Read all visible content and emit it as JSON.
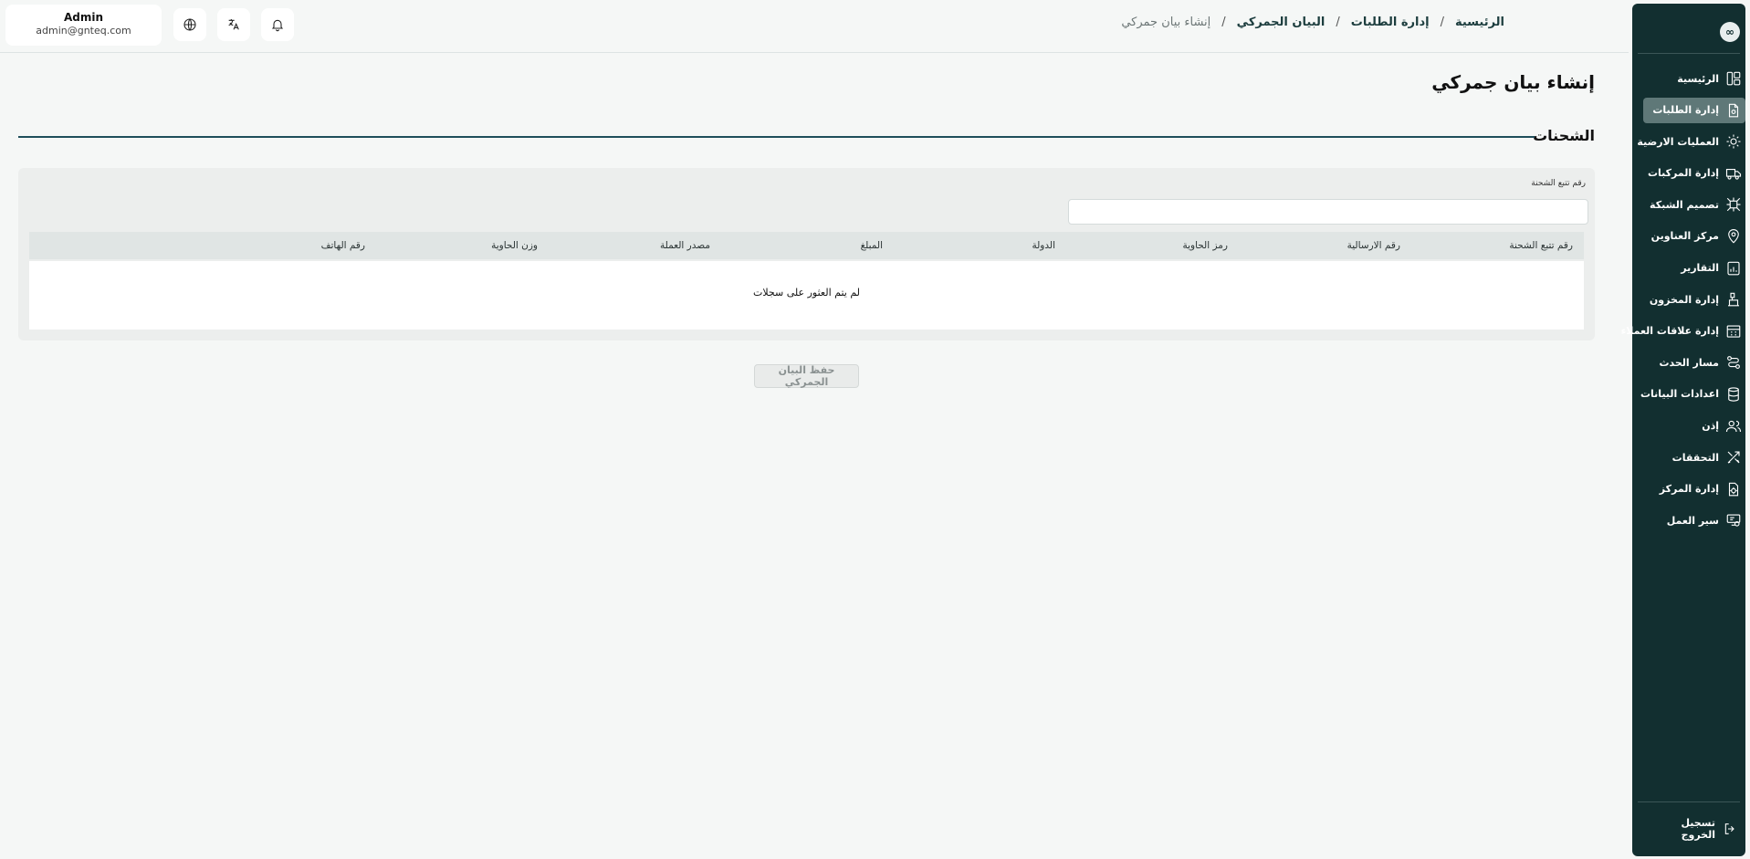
{
  "user": {
    "name": "Admin",
    "email": "admin@gnteq.com"
  },
  "header": {
    "breadcrumbs": [
      "الرئيسية",
      "إدارة الطلبات",
      "البيان الجمركي",
      "إنشاء بيان جمركي"
    ],
    "separator": "/"
  },
  "sidebar": {
    "logo": "∞",
    "items": [
      {
        "label": "الرئيسية",
        "icon": "dashboard-icon"
      },
      {
        "label": "إدارة الطلبات",
        "icon": "order-file-icon",
        "active": true
      },
      {
        "label": "العمليات الارضية",
        "icon": "ground-ops-icon"
      },
      {
        "label": "إدارة المركبات",
        "icon": "truck-icon"
      },
      {
        "label": "تصميم الشبكة",
        "icon": "network-icon"
      },
      {
        "label": "مركز العناوين",
        "icon": "location-pin-icon"
      },
      {
        "label": "التقارير",
        "icon": "report-chart-icon"
      },
      {
        "label": "إدارة المخزون",
        "icon": "inventory-icon"
      },
      {
        "label": "إدارة علاقات العملاء",
        "icon": "crm-icon"
      },
      {
        "label": "مسار الحدث",
        "icon": "route-icon"
      },
      {
        "label": "اعدادات البيانات",
        "icon": "database-icon"
      },
      {
        "label": "إذن",
        "icon": "users-icon"
      },
      {
        "label": "التحققات",
        "icon": "tools-icon"
      },
      {
        "label": "إدارة المركز",
        "icon": "hub-settings-icon"
      },
      {
        "label": "سير العمل",
        "icon": "workflow-icon"
      }
    ],
    "logout": "تسجيل الخروج"
  },
  "main": {
    "title": "إنشاء بيان جمركي",
    "section": "الشحنات",
    "tracking_label": "رقم تتبع الشحنة",
    "tracking_value": "",
    "columns": [
      "رقم تتبع الشحنة",
      "رقم الارسالية",
      "رمز الحاوية",
      "الدولة",
      "المبلغ",
      "مصدر العملة",
      "وزن الحاوية",
      "رقم الهاتف"
    ],
    "empty_message": "لم يتم العثور على سجلات",
    "save_label": "حفظ البيان الجمركي"
  },
  "colors": {
    "sidebar": "#122f30",
    "active_item": "#5f7878",
    "section_line": "#1f4e5a",
    "background": "#f5f7f6"
  }
}
